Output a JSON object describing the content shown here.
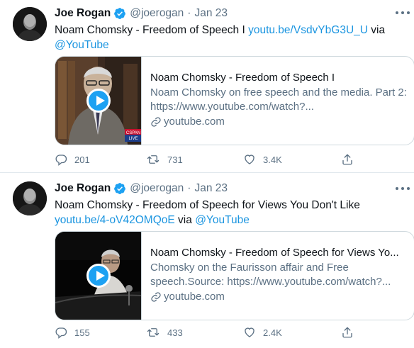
{
  "colors": {
    "link": "#1b95e0",
    "verified": "#1da1f2",
    "secondary": "#5b7083",
    "border": "#cfd9de"
  },
  "tweets": [
    {
      "author_name": "Joe Rogan",
      "handle": "@joerogan",
      "separator": "·",
      "date": "Jan 23",
      "text_before": "Noam Chomsky - Freedom of Speech I ",
      "text_link": "youtu.be/VsdvYbG3U_U",
      "text_middle": " via ",
      "text_mention": "@YouTube",
      "card": {
        "title": "Noam Chomsky - Freedom of Speech I",
        "description": "Noam Chomsky on free speech and the media. Part 2: https://www.youtube.com/watch?...",
        "domain": "youtube.com",
        "thumb_badge": "CSPAN LIVE"
      },
      "replies": "201",
      "retweets": "731",
      "likes": "3.4K"
    },
    {
      "author_name": "Joe Rogan",
      "handle": "@joerogan",
      "separator": "·",
      "date": "Jan 23",
      "text_before": "Noam Chomsky - Freedom of Speech for Views You Don't Like ",
      "text_link": "youtu.be/4-oV42OMQoE",
      "text_middle": " via ",
      "text_mention": "@YouTube",
      "card": {
        "title": "Noam Chomsky - Freedom of Speech for Views Yo...",
        "description": "Chomsky on the Faurisson affair and Free speech.Source: https://www.youtube.com/watch?...",
        "domain": "youtube.com"
      },
      "replies": "155",
      "retweets": "433",
      "likes": "2.4K"
    }
  ],
  "icons": {
    "reply": "reply-icon",
    "retweet": "retweet-icon",
    "like": "heart-icon",
    "share": "share-icon",
    "more": "more-icon",
    "verified": "verified-badge-icon",
    "link": "link-icon",
    "play": "play-icon"
  }
}
